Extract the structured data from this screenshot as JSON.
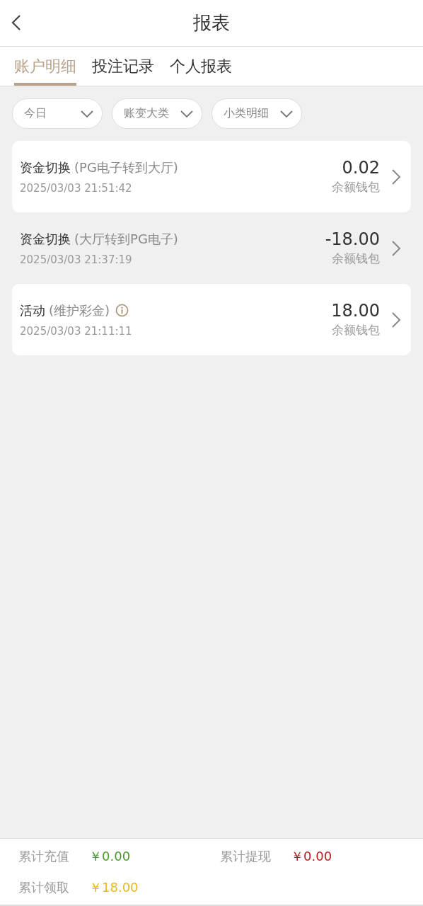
{
  "header": {
    "title": "报表"
  },
  "tabs": [
    {
      "label": "账户明细",
      "selected": true
    },
    {
      "label": "投注记录",
      "selected": false
    },
    {
      "label": "个人报表",
      "selected": false
    }
  ],
  "filters": [
    {
      "label": "今日"
    },
    {
      "label": "账变大类"
    },
    {
      "label": "小类明细"
    }
  ],
  "records": [
    {
      "title": "资金切换",
      "detail": "(PG电子转到大厅)",
      "time": "2025/03/03 21:51:42",
      "amount": "0.02",
      "wallet": "余额钱包",
      "framed": true,
      "info": false
    },
    {
      "title": "资金切换",
      "detail": "(大厅转到PG电子)",
      "time": "2025/03/03 21:37:19",
      "amount": "-18.00",
      "wallet": "余额钱包",
      "framed": false,
      "info": false
    },
    {
      "title": "活动",
      "detail": "(维护彩金)",
      "time": "2025/03/03 21:11:11",
      "amount": "18.00",
      "wallet": "余额钱包",
      "framed": true,
      "info": true
    }
  ],
  "totals": [
    {
      "label": "累计充值",
      "value": "￥0.00",
      "color": "#4a9a2c"
    },
    {
      "label": "累计提现",
      "value": "￥0.00",
      "color": "#b81c1c"
    },
    {
      "label": "累计领取",
      "value": "￥18.00",
      "color": "#e8b820"
    }
  ]
}
